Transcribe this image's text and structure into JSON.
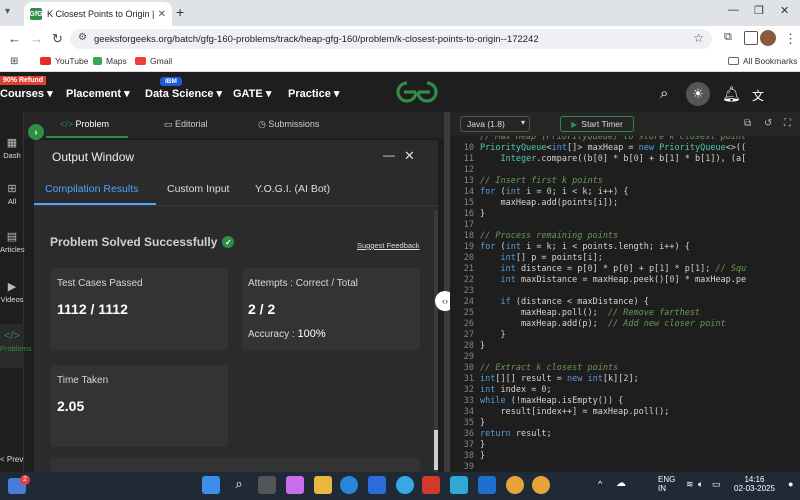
{
  "browser": {
    "tab_title": "K Closest Points to Origin | Prac",
    "tab_favicon": "GfG",
    "url": "geeksforgeeks.org/batch/gfg-160-problems/track/heap-gfg-160/problem/k-closest-points-to-origin--172242",
    "bookmarks": [
      "YouTube",
      "Maps",
      "Gmail"
    ],
    "all_bookmarks": "All Bookmarks"
  },
  "site": {
    "refund_badge": "90% Refund",
    "ibm_badge": "IBM",
    "nav": [
      "Courses",
      "Placement",
      "Data Science",
      "GATE",
      "Practice"
    ],
    "nav_caret": "▾"
  },
  "rail": [
    "Dash",
    "All",
    "Articles",
    "Videos",
    "Problems"
  ],
  "rail_prev": "< Prev",
  "problem_tabs": {
    "problem": "Problem",
    "editorial": "Editorial",
    "submissions": "Submissions"
  },
  "output": {
    "title": "Output Window",
    "tabs": [
      "Compilation Results",
      "Custom Input",
      "Y.O.G.I. (AI Bot)"
    ],
    "status": "Problem Solved Successfully",
    "suggest": "Suggest Feedback",
    "tests_label": "Test Cases Passed",
    "tests_value": "1112 / 1112",
    "attempts_label": "Attempts : Correct / Total",
    "attempts_value": "2 / 2",
    "accuracy_label": "Accuracy :",
    "accuracy_value": "100%",
    "time_label": "Time Taken",
    "time_value": "2.05"
  },
  "editor": {
    "language": "Java (1.8)",
    "timer": "Start Timer",
    "lines": [
      {
        "n": "",
        "t": "// Max Heap (PriorityQueue) to store k closest point"
      },
      {
        "n": "10",
        "t": "PriorityQueue<int[]> maxHeap = new PriorityQueue<>(("
      },
      {
        "n": "11",
        "t": "    Integer.compare((b[0] * b[0] + b[1] * b[1]), (a["
      },
      {
        "n": "12",
        "t": ""
      },
      {
        "n": "13",
        "t": "// Insert first k points"
      },
      {
        "n": "14",
        "t": "for (int i = 0; i < k; i++) {"
      },
      {
        "n": "15",
        "t": "    maxHeap.add(points[i]);"
      },
      {
        "n": "16",
        "t": "}"
      },
      {
        "n": "17",
        "t": ""
      },
      {
        "n": "18",
        "t": "// Process remaining points"
      },
      {
        "n": "19",
        "t": "for (int i = k; i < points.length; i++) {"
      },
      {
        "n": "20",
        "t": "    int[] p = points[i];"
      },
      {
        "n": "21",
        "t": "    int distance = p[0] * p[0] + p[1] * p[1]; // Squ"
      },
      {
        "n": "22",
        "t": "    int maxDistance = maxHeap.peek()[0] * maxHeap.pe"
      },
      {
        "n": "23",
        "t": ""
      },
      {
        "n": "24",
        "t": "    if (distance < maxDistance) {"
      },
      {
        "n": "25",
        "t": "        maxHeap.poll();  // Remove farthest"
      },
      {
        "n": "26",
        "t": "        maxHeap.add(p);  // Add new closer point"
      },
      {
        "n": "27",
        "t": "    }"
      },
      {
        "n": "28",
        "t": "}"
      },
      {
        "n": "29",
        "t": ""
      },
      {
        "n": "30",
        "t": "// Extract k closest points"
      },
      {
        "n": "31",
        "t": "int[][] result = new int[k][2];"
      },
      {
        "n": "32",
        "t": "int index = 0;"
      },
      {
        "n": "33",
        "t": "while (!maxHeap.isEmpty()) {"
      },
      {
        "n": "34",
        "t": "    result[index++] = maxHeap.poll();"
      },
      {
        "n": "35",
        "t": "}"
      },
      {
        "n": "36",
        "t": "return result;"
      },
      {
        "n": "37",
        "t": "}"
      },
      {
        "n": "38",
        "t": "}"
      },
      {
        "n": "39",
        "t": ""
      }
    ]
  },
  "taskbar": {
    "lang_top": "ENG",
    "lang_bottom": "IN",
    "time": "14:16",
    "date": "02-03-2025",
    "notif": "2"
  },
  "colors": {
    "gfg_green": "#2f8d46",
    "accent_blue": "#4fa3ff"
  }
}
